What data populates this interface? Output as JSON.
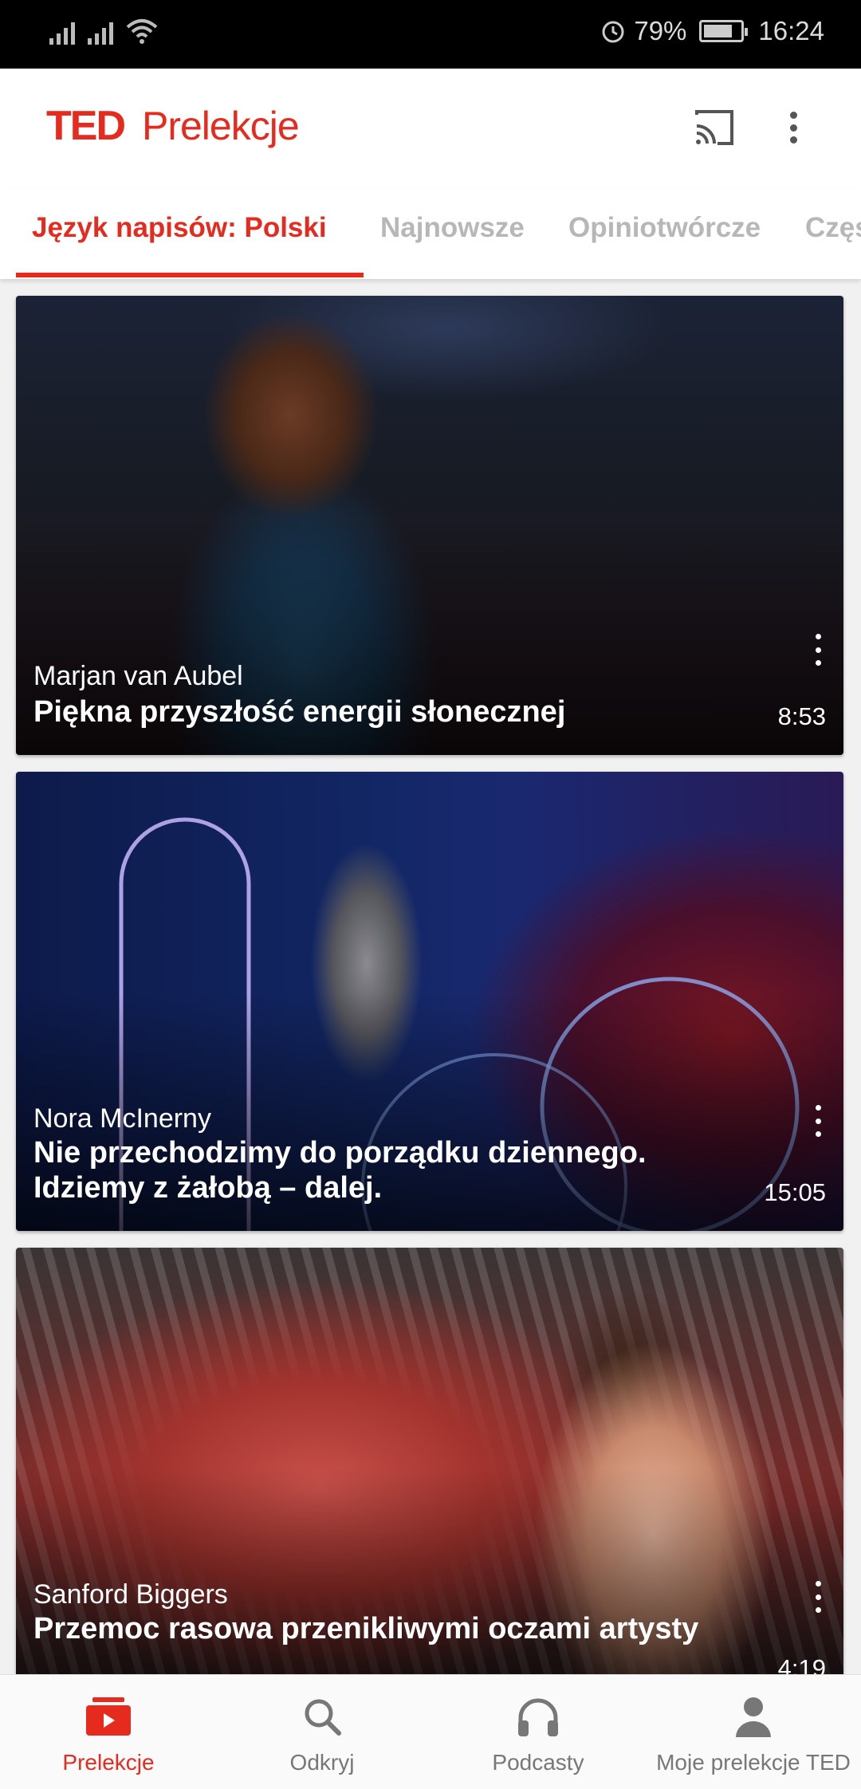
{
  "status_bar": {
    "alarm_icon": "alarm-icon",
    "battery": "79%",
    "battery_level": 0.79,
    "time": "16:24"
  },
  "app_bar": {
    "logo_brand": "TED",
    "logo_title": "Prelekcje",
    "cast_icon": "cast-icon",
    "more_icon": "more-vert-icon"
  },
  "tabs": [
    {
      "label": "Język napisów: Polski",
      "active": true
    },
    {
      "label": "Najnowsze",
      "active": false
    },
    {
      "label": "Opiniotwórcze",
      "active": false
    },
    {
      "label": "Częs",
      "active": false
    }
  ],
  "talks": [
    {
      "speaker": "Marjan van Aubel",
      "title": "Piękna przyszłość energii słonecznej",
      "duration": "8:53"
    },
    {
      "speaker": "Nora McInerny",
      "title": "Nie przechodzimy do porządku dziennego. Idziemy z żałobą – dalej.",
      "duration": "15:05"
    },
    {
      "speaker": "Sanford Biggers",
      "title": "Przemoc rasowa przenikliwymi oczami artysty",
      "duration": "4:19"
    }
  ],
  "bottom_nav": [
    {
      "label": "Prelekcje",
      "icon": "talks-icon",
      "active": true
    },
    {
      "label": "Odkryj",
      "icon": "search-icon",
      "active": false
    },
    {
      "label": "Podcasty",
      "icon": "headphones-icon",
      "active": false
    },
    {
      "label": "Moje prelekcje TED",
      "icon": "profile-icon",
      "active": false
    }
  ],
  "colors": {
    "accent": "#e62b1e",
    "inactive_tab": "#b7b7b7",
    "status_bar": "#000000"
  }
}
